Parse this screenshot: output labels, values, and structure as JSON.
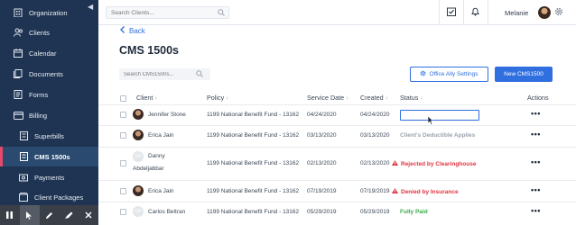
{
  "sidebar": {
    "items": [
      {
        "label": "Organization",
        "icon": "building-icon"
      },
      {
        "label": "Clients",
        "icon": "users-icon"
      },
      {
        "label": "Calendar",
        "icon": "calendar-icon"
      },
      {
        "label": "Documents",
        "icon": "documents-icon"
      },
      {
        "label": "Forms",
        "icon": "forms-icon"
      },
      {
        "label": "Billing",
        "icon": "credit-card-icon"
      },
      {
        "label": "Superbills",
        "icon": "superbill-icon"
      },
      {
        "label": "CMS 1500s",
        "icon": "cms-form-icon"
      },
      {
        "label": "Payments",
        "icon": "payments-icon"
      },
      {
        "label": "Client Packages",
        "icon": "package-icon"
      }
    ],
    "active_color": "#e8486b"
  },
  "topbar": {
    "search_placeholder": "Search Clients...",
    "user_name": "Melanie"
  },
  "page": {
    "back_label": "Back",
    "title": "CMS 1500s",
    "search_placeholder": "Search CMS1500s...",
    "office_ally_label": "Office Ally Settings",
    "new_label": "New CMS1500"
  },
  "table": {
    "headers": {
      "client": "Client",
      "policy": "Policy",
      "service_date": "Service Date",
      "created": "Created",
      "status": "Status",
      "actions": "Actions"
    },
    "rows": [
      {
        "client": "Jennifer Stone",
        "client_line2": "",
        "initials": "",
        "policy": "1199 National Benefit Fund - 13162",
        "service_date": "04/24/2020",
        "created": "04/24/2020",
        "status": "",
        "status_color": ""
      },
      {
        "client": "Erica Jain",
        "client_line2": "",
        "initials": "",
        "policy": "1199 National Benefit Fund - 13162",
        "service_date": "03/13/2020",
        "created": "03/13/2020",
        "status": "Client's Deductible Applies",
        "status_color": "#9aa3ad"
      },
      {
        "client": "Danny",
        "client_line2": "Abdeljabbar",
        "initials": "DA",
        "policy": "1199 National Benefit Fund - 13162",
        "service_date": "02/13/2020",
        "created": "02/13/2020",
        "status": "Rejected by Clearinghouse",
        "status_color": "#e0333f"
      },
      {
        "client": "Erica Jain",
        "client_line2": "",
        "initials": "",
        "policy": "1199 National Benefit Fund - 13162",
        "service_date": "07/19/2019",
        "created": "07/19/2019",
        "status": "Denied by Insurance",
        "status_color": "#e0333f"
      },
      {
        "client": "Carlos Beltran",
        "client_line2": "",
        "initials": "CB",
        "policy": "1199 National Benefit Fund - 13162",
        "service_date": "05/29/2019",
        "created": "05/29/2019",
        "status": "Fully Paid",
        "status_color": "#3aaa4a"
      }
    ],
    "actions_glyph": "•••"
  }
}
